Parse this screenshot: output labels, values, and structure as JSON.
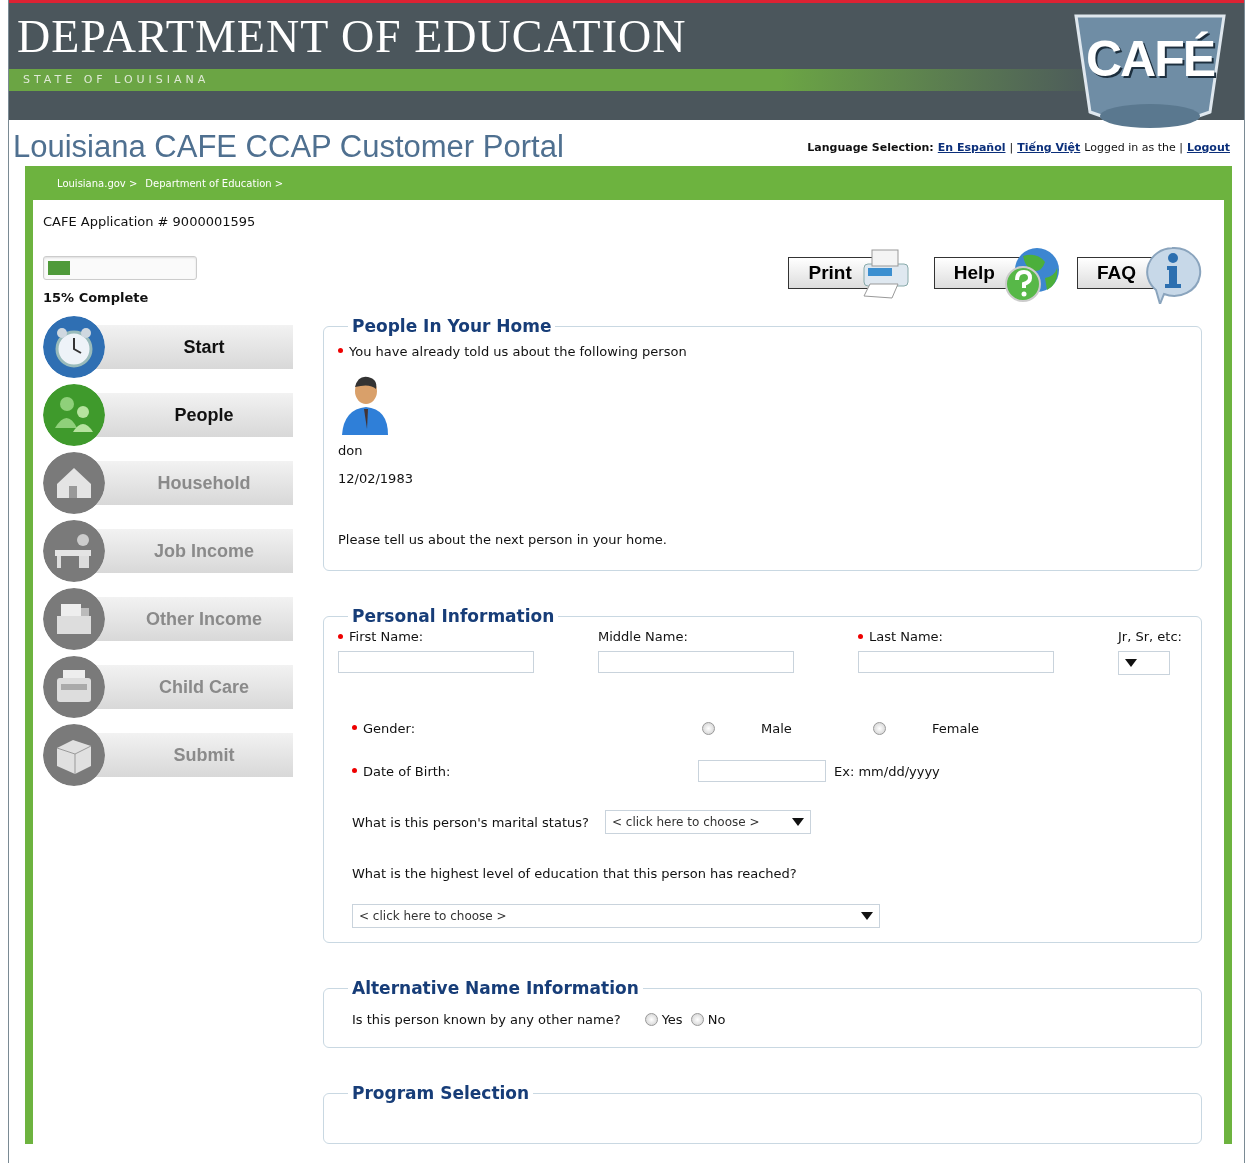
{
  "header": {
    "title": "DEPARTMENT OF EDUCATION",
    "subtitle": "STATE OF LOUISIANA",
    "logo": "CAFÉ"
  },
  "portal_title": "Louisiana CAFE CCAP Customer Portal",
  "top_links": [
    {
      "kind": "label",
      "text": "Language Selection:"
    },
    {
      "kind": "link",
      "text": "En Español"
    },
    {
      "kind": "text",
      "text": "|"
    },
    {
      "kind": "link",
      "text": "Tiếng Việt"
    },
    {
      "kind": "text",
      "text": "Logged in as the |"
    },
    {
      "kind": "link",
      "text": "Logout"
    }
  ],
  "breadcrumbs": [
    "Louisiana.gov >",
    "Department of Education >"
  ],
  "application": "CAFE Application # 9000001595",
  "progress": {
    "level": 0.15,
    "label": "15% Complete"
  },
  "steps": [
    {
      "label": "Start",
      "enabled": true,
      "color": "#2f6fb3"
    },
    {
      "label": "People",
      "enabled": true,
      "color": "#3f9a2c"
    },
    {
      "label": "Household",
      "enabled": false,
      "color": "#7a7a7a"
    },
    {
      "label": "Job Income",
      "enabled": false,
      "color": "#7a7a7a"
    },
    {
      "label": "Other Income",
      "enabled": false,
      "color": "#7a7a7a"
    },
    {
      "label": "Child Care",
      "enabled": false,
      "color": "#7a7a7a"
    },
    {
      "label": "Submit",
      "enabled": false,
      "color": "#7a7a7a"
    }
  ],
  "tools": [
    "Print",
    "Help",
    "FAQ"
  ],
  "people_section": {
    "title": "People In Your Home",
    "intro": "You have already told us about the following person",
    "intro_required": true,
    "person": {
      "name": "don",
      "birth_date": "12/02/1983"
    },
    "prompt": "Please tell us about the next person in your home."
  },
  "personal_info": {
    "title": "Personal Information",
    "name_fields": [
      {
        "label": "First Name:",
        "required": true,
        "kind": "text"
      },
      {
        "label": "Middle Name:",
        "required": false,
        "kind": "text"
      },
      {
        "label": "Last Name:",
        "required": true,
        "kind": "text"
      },
      {
        "label": "Jr, Sr, etc:",
        "required": false,
        "kind": "select"
      }
    ],
    "gender": {
      "label": "Gender:",
      "required": true,
      "options": [
        {
          "label": "Male",
          "checked": false
        },
        {
          "label": "Female",
          "checked": false
        }
      ]
    },
    "birth_date": {
      "label": "Date of Birth:",
      "required": true,
      "hint": "Ex: mm/dd/yyyy"
    },
    "marital": {
      "question": "What is this person's marital status?",
      "value": "< click here to choose >"
    },
    "education": {
      "question": "What is the highest level of education that this person has reached?",
      "value": "< click here to choose >"
    }
  },
  "alternative_name": {
    "title": "Alternative Name Information",
    "question": "Is this person known by any other name?",
    "options": [
      {
        "label": "Yes",
        "checked": false
      },
      {
        "label": "No",
        "checked": false
      }
    ]
  },
  "program_selection": {
    "title": "Program Selection"
  }
}
